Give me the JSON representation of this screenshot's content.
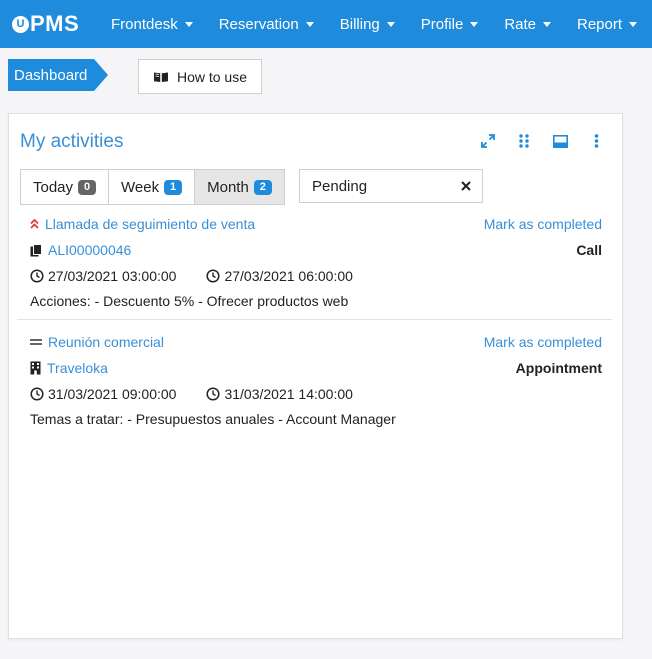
{
  "app": {
    "logo_letter": "U",
    "logo_text": "PMS"
  },
  "nav": {
    "items": [
      {
        "label": "Frontdesk"
      },
      {
        "label": "Reservation"
      },
      {
        "label": "Billing"
      },
      {
        "label": "Profile"
      },
      {
        "label": "Rate"
      },
      {
        "label": "Report"
      }
    ]
  },
  "breadcrumb": {
    "current": "Dashboard"
  },
  "help": {
    "label": "How to use",
    "icon": "book-icon"
  },
  "panel": {
    "title": "My activities",
    "tools": [
      "expand-icon",
      "grid-dots-icon",
      "minimize-window-icon",
      "more-vertical-icon"
    ],
    "tabs": [
      {
        "label": "Today",
        "count": "0",
        "badge_color": "#666666"
      },
      {
        "label": "Week",
        "count": "1",
        "badge_color": "#1e8bdc"
      },
      {
        "label": "Month",
        "count": "2",
        "badge_color": "#1e8bdc",
        "active": true
      }
    ],
    "status_filter": {
      "value": "Pending"
    },
    "activities": [
      {
        "priority_icon": "priority-high-icon",
        "title": "Llamada de seguimiento de venta",
        "mark_label": "Mark as completed",
        "ref_icon": "document-copy-icon",
        "ref": "ALI00000046",
        "type": "Call",
        "start": "27/03/2021 03:00:00",
        "end": "27/03/2021 06:00:00",
        "description": "Acciones: - Descuento 5% - Ofrecer productos web"
      },
      {
        "priority_icon": "priority-medium-icon",
        "title": "Reunión comercial",
        "mark_label": "Mark as completed",
        "ref_icon": "building-icon",
        "ref": "Traveloka",
        "type": "Appointment",
        "start": "31/03/2021 09:00:00",
        "end": "31/03/2021 14:00:00",
        "description": "Temas a tratar: - Presupuestos anuales - Account Manager"
      }
    ]
  },
  "colors": {
    "brand": "#1e8bdc",
    "link": "#3a8fd6",
    "priority_high": "#e0393e",
    "priority_medium": "#666666"
  }
}
